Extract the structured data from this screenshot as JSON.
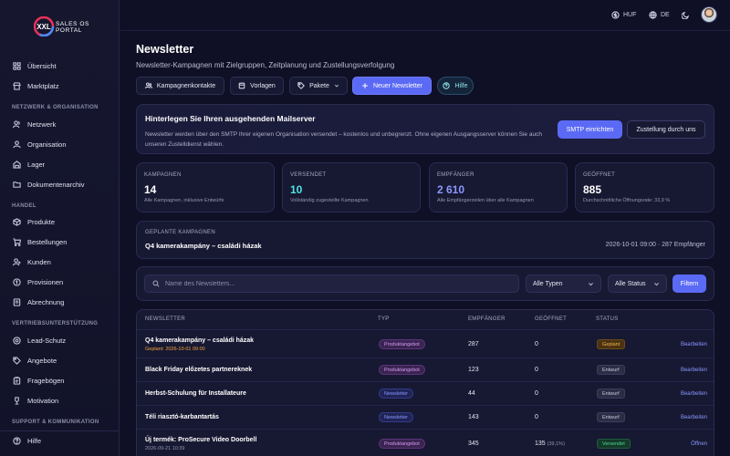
{
  "app": {
    "logo_text_1": "SALES OS",
    "logo_text_2": "PORTAL",
    "logo_mark": "XXL"
  },
  "sidebar": {
    "items_top": [
      {
        "label": "Übersicht",
        "icon": "grid-icon"
      },
      {
        "label": "Marktplatz",
        "icon": "store-icon"
      }
    ],
    "section_network": "NETZWERK & ORGANISATION",
    "items_network": [
      {
        "label": "Netzwerk",
        "icon": "users-icon"
      },
      {
        "label": "Organisation",
        "icon": "org-icon"
      },
      {
        "label": "Lager",
        "icon": "warehouse-icon"
      },
      {
        "label": "Dokumentenarchiv",
        "icon": "folder-icon"
      }
    ],
    "section_trade": "HANDEL",
    "items_trade": [
      {
        "label": "Produkte",
        "icon": "box-icon"
      },
      {
        "label": "Bestellungen",
        "icon": "cart-icon"
      },
      {
        "label": "Kunden",
        "icon": "user-icon"
      },
      {
        "label": "Provisionen",
        "icon": "coins-icon"
      },
      {
        "label": "Abrechnung",
        "icon": "receipt-icon"
      }
    ],
    "section_support": "VERTRIEBSUNTERSTÜTZUNG",
    "items_support": [
      {
        "label": "Lead-Schutz",
        "icon": "shield-icon"
      },
      {
        "label": "Angebote",
        "icon": "tag-icon"
      },
      {
        "label": "Fragebögen",
        "icon": "clipboard-icon"
      },
      {
        "label": "Motivation",
        "icon": "trophy-icon"
      }
    ],
    "section_comm": "SUPPORT & KOMMUNIKATION",
    "help_label": "Hilfe"
  },
  "topbar": {
    "currency": "HUF",
    "language": "DE"
  },
  "page": {
    "title": "Newsletter",
    "subtitle": "Newsletter-Kampagnen mit Zielgruppen, Zeitplanung und Zustellungsverfolgung"
  },
  "toolbar": {
    "contacts": "Kampagnenkontakte",
    "templates": "Vorlagen",
    "packages": "Pakete",
    "new_newsletter": "Neuer Newsletter",
    "help": "Hilfe"
  },
  "smtp": {
    "title": "Hinterlegen Sie Ihren ausgehenden Mailserver",
    "text": "Newsletter werden über den SMTP Ihrer eigenen Organisation versendet – kostenlos und unbegrenzt. Ohne eigenen Ausgangsserver können Sie auch unseren Zustelldienst wählen.",
    "setup_button": "SMTP einrichten",
    "delivery_button": "Zustellung durch uns"
  },
  "stats": [
    {
      "label": "KAMPAGNEN",
      "value": "14",
      "desc": "Alle Kampagnen, inklusive Entwürfe",
      "color": "#ffffff"
    },
    {
      "label": "VERSENDET",
      "value": "10",
      "desc": "Vollständig zugestellte Kampagnen",
      "color": "#4fe3e6"
    },
    {
      "label": "EMPFÄNGER",
      "value": "2 610",
      "desc": "Alle Empfängerzeilen über alle Kampagnen",
      "color": "#8b97ff"
    },
    {
      "label": "GEÖFFNET",
      "value": "885",
      "desc": "Durchschnittliche Öffnungsrate: 33,9 %",
      "color": "#ffffff"
    }
  ],
  "planned": {
    "label": "GEPLANTE KAMPAGNEN",
    "name": "Q4 kamerakampány – családi házak",
    "meta": "2026-10-01 09:00 · 287 Empfänger"
  },
  "filters": {
    "search_placeholder": "Name des Newsletters...",
    "type_value": "Alle Typen",
    "status_value": "Alle Status",
    "filter_button": "Filtern"
  },
  "table": {
    "headers": {
      "name": "NEWSLETTER",
      "type": "TYP",
      "recipients": "EMPFÄNGER",
      "opened": "GEÖFFNET",
      "status": "STATUS"
    },
    "rows": [
      {
        "name": "Q4 kamerakampány – családi házak",
        "sub": "Geplant: 2026-10-01 09:00",
        "sub_color": "#f5a53a",
        "type": "Produktangebot",
        "type_kind": "product",
        "recipients": "287",
        "opened": "0",
        "opened_pct": "",
        "status": "Geplant",
        "status_kind": "geplant",
        "action": "Bearbeiten"
      },
      {
        "name": "Black Friday előzetes partnereknek",
        "sub": "",
        "sub_color": "",
        "type": "Produktangebot",
        "type_kind": "product",
        "recipients": "123",
        "opened": "0",
        "opened_pct": "",
        "status": "Entwurf",
        "status_kind": "entwurf",
        "action": "Bearbeiten"
      },
      {
        "name": "Herbst-Schulung für Installateure",
        "sub": "",
        "sub_color": "",
        "type": "Newsletter",
        "type_kind": "newsletter",
        "recipients": "44",
        "opened": "0",
        "opened_pct": "",
        "status": "Entwurf",
        "status_kind": "entwurf",
        "action": "Bearbeiten"
      },
      {
        "name": "Téli riasztó-karbantartás",
        "sub": "",
        "sub_color": "",
        "type": "Newsletter",
        "type_kind": "newsletter",
        "recipients": "143",
        "opened": "0",
        "opened_pct": "",
        "status": "Entwurf",
        "status_kind": "entwurf",
        "action": "Bearbeiten"
      },
      {
        "name": "Új termék: ProSecure Video Doorbell",
        "sub": "2026-09-21 10:39",
        "sub_color": "#9496b3",
        "type": "Produktangebot",
        "type_kind": "product",
        "recipients": "345",
        "opened": "135",
        "opened_pct": "(39,1%)",
        "status": "Versendet",
        "status_kind": "versendet",
        "action": "Öffnen"
      }
    ]
  }
}
